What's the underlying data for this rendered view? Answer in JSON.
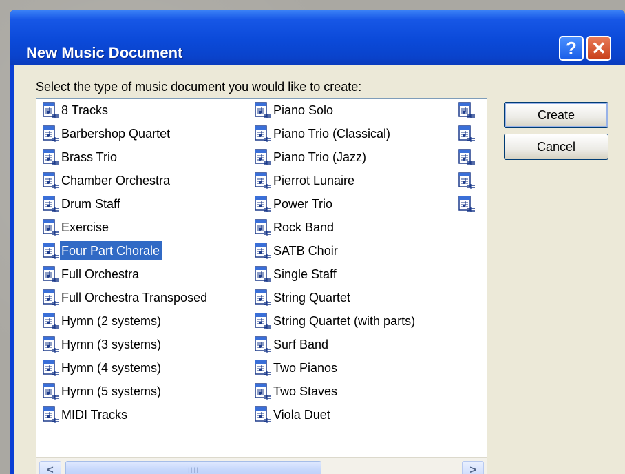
{
  "window": {
    "title": "New Music Document",
    "help_label": "?",
    "close_label": "✕"
  },
  "dialog": {
    "prompt": "Select the type of music document you would like to create:",
    "create_label": "Create",
    "cancel_label": "Cancel"
  },
  "list": {
    "selected": "Four Part Chorale",
    "columns": [
      [
        "8 Tracks",
        "Barbershop Quartet",
        "Brass Trio",
        "Chamber Orchestra",
        "Drum Staff",
        "Exercise",
        "Four Part Chorale",
        "Full Orchestra",
        "Full Orchestra Transposed",
        "Hymn (2 systems)",
        "Hymn (3 systems)",
        "Hymn (4 systems)",
        "Hymn (5 systems)",
        "MIDI Tracks"
      ],
      [
        "Piano Solo",
        "Piano Trio (Classical)",
        "Piano Trio (Jazz)",
        "Pierrot Lunaire",
        "Power Trio",
        "Rock Band",
        "SATB Choir",
        "Single Staff",
        "String Quartet",
        "String Quartet (with parts)",
        "Surf Band",
        "Two Pianos",
        "Two Staves",
        "Viola Duet"
      ],
      [
        "",
        "",
        "",
        "",
        ""
      ]
    ]
  },
  "scrollbar": {
    "left_arrow": "<",
    "right_arrow": ">",
    "thumb_grip": "IIII"
  },
  "icon": "music-document-icon"
}
